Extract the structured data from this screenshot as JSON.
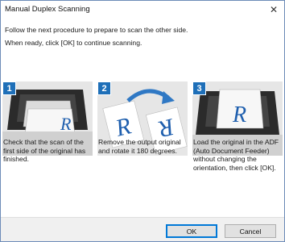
{
  "window": {
    "title": "Manual Duplex Scanning",
    "close_glyph": "✕"
  },
  "instructions": {
    "line1": "Follow the next procedure to prepare to scan the other side.",
    "line2": "When ready, click [OK] to continue scanning."
  },
  "steps": [
    {
      "number": "1",
      "caption": "Check that the scan of the first side of the original has finished.",
      "illustration": "scanner-output-tray-icon"
    },
    {
      "number": "2",
      "caption": "Remove the output original and rotate it 180 degrees.",
      "illustration": "rotate-original-icon"
    },
    {
      "number": "3",
      "caption": "Load the original in the ADF (Auto Document Feeder) without changing the orientation, then click [OK].",
      "illustration": "load-adf-icon"
    }
  ],
  "illustration_letter": "R",
  "buttons": {
    "ok": "OK",
    "cancel": "Cancel"
  },
  "colors": {
    "badge": "#1e6fb8",
    "letter": "#1f5fae",
    "arrow": "#2f78c4"
  }
}
